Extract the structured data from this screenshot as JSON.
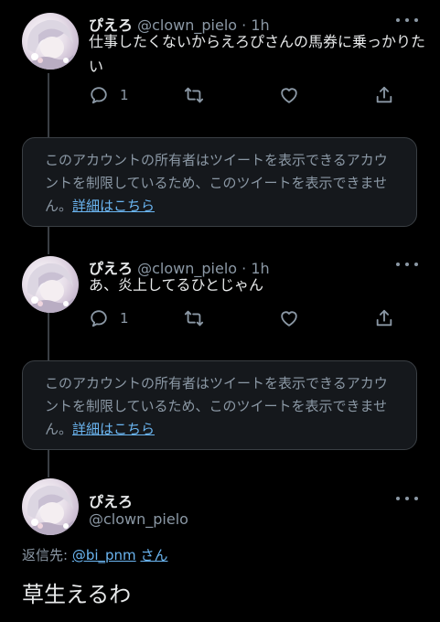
{
  "tweets": [
    {
      "name": "ぴえろ",
      "handle": "@clown_pielo",
      "sep": "·",
      "time": "1h",
      "text": "仕事したくないからえろぴさんの馬券に乗っかりたい",
      "reply_count": "1",
      "notice": {
        "text": "このアカウントの所有者はツイートを表示できるアカウントを制限しているため、このツイートを表示できません。",
        "link": "詳細はこちら"
      }
    },
    {
      "name": "ぴえろ",
      "handle": "@clown_pielo",
      "sep": "·",
      "time": "1h",
      "text": "あ、炎上してるひとじゃん",
      "reply_count": "1",
      "notice": {
        "text": "このアカウントの所有者はツイートを表示できるアカウントを制限しているため、このツイートを表示できません。",
        "link": "詳細はこちら"
      }
    }
  ],
  "main_tweet": {
    "name": "ぴえろ",
    "handle": "@clown_pielo",
    "reply_prefix": "返信先: ",
    "reply_user": "@bi_pnm",
    "reply_suffix": "さん",
    "text": "草生えるわ"
  },
  "icons": [
    "reply-icon",
    "retweet-icon",
    "like-icon",
    "share-icon",
    "more-icon"
  ],
  "colors": {
    "background": "#000000",
    "text": "#e7e9ea",
    "muted": "#8b98a5",
    "link": "#6bb6f2",
    "card": "#15181c",
    "border": "#3a3f44"
  }
}
